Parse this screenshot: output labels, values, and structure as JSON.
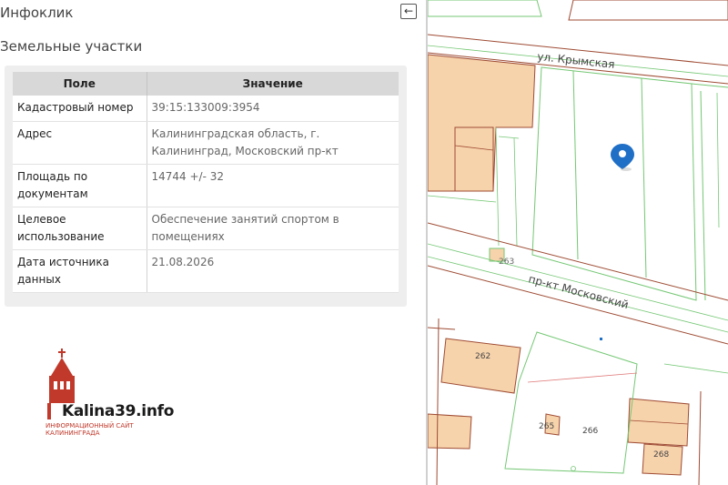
{
  "panel": {
    "title": "Инфоклик",
    "collapse_icon": "←",
    "section_title": "Земельные участки"
  },
  "table": {
    "headers": {
      "field": "Поле",
      "value": "Значение"
    },
    "rows": [
      {
        "key": "Кадастровый номер",
        "value": "39:15:133009:3954"
      },
      {
        "key": "Адрес",
        "value": "Калининградская область, г. Калининград, Московский пр-кт"
      },
      {
        "key": "Площадь по документам",
        "value": "14744 +/- 32"
      },
      {
        "key": "Целевое использование",
        "value": "Обеспечение занятий спортом в помещениях"
      },
      {
        "key": "Дата источника данных",
        "value": "21.08.2026"
      }
    ]
  },
  "logo": {
    "name": "Kalina39.info",
    "subtitle_line1": "ИНФОРМАЦИОННЫЙ САЙТ",
    "subtitle_line2": "КАЛИНИНГРАДА"
  },
  "map": {
    "street_crimean": "ул. Крымская",
    "street_moscow": "пр-кт Московский",
    "building_labels": [
      "263",
      "262",
      "265",
      "266",
      "268"
    ],
    "marker_icon": "map-pin-icon",
    "colors": {
      "building_fill": "#f7d3ac",
      "building_stroke": "#9e4b33",
      "parcel_line": "#74c774",
      "marker": "#1f6fc7"
    }
  }
}
